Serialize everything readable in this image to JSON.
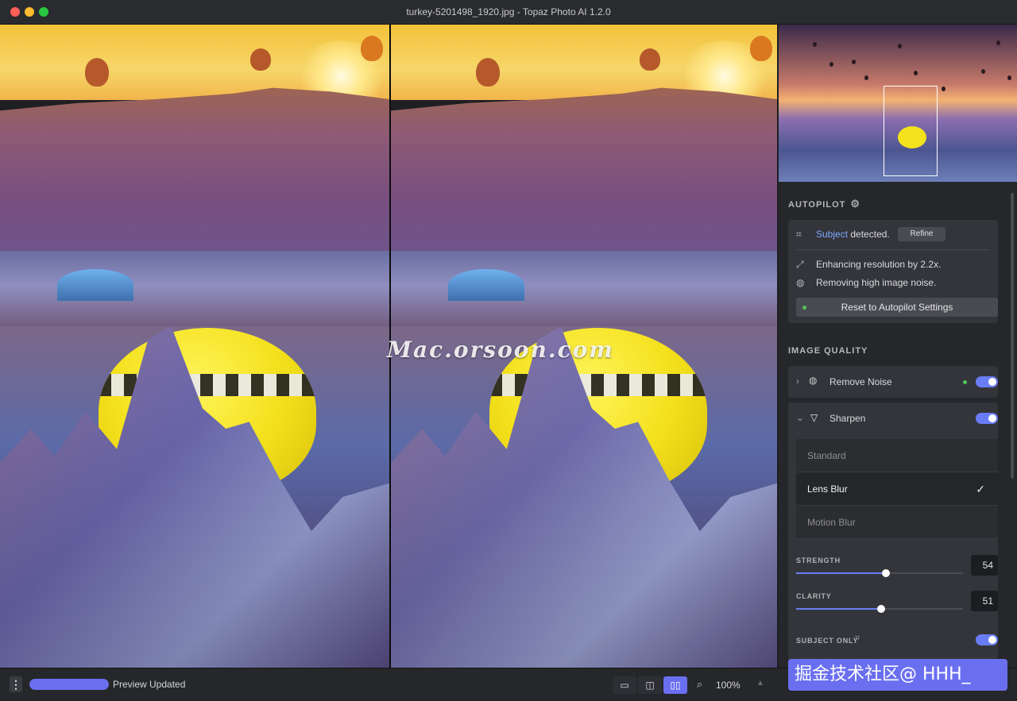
{
  "window": {
    "title": "turkey-5201498_1920.jpg - Topaz Photo AI 1.2.0"
  },
  "watermark": "Mac.orsoon.com",
  "sidebar": {
    "autopilot": {
      "heading": "AUTOPILOT",
      "subject_link": "Subject",
      "subject_suffix": "detected.",
      "refine_label": "Refine",
      "resolution_text": "Enhancing resolution by 2.2x.",
      "noise_text": "Removing high image noise.",
      "reset_label": "Reset to Autopilot Settings"
    },
    "image_quality": {
      "heading": "IMAGE QUALITY",
      "remove_noise": {
        "label": "Remove Noise",
        "enabled": true
      },
      "sharpen": {
        "label": "Sharpen",
        "enabled": true,
        "modes": [
          "Standard",
          "Lens Blur",
          "Motion Blur"
        ],
        "selected_mode": "Lens Blur",
        "strength": {
          "label": "STRENGTH",
          "value": 54
        },
        "clarity": {
          "label": "CLARITY",
          "value": 51
        },
        "subject_only": {
          "label": "SUBJECT ONLY",
          "enabled": true
        }
      }
    }
  },
  "bottombar": {
    "status": "Preview Updated",
    "progress": 1.0,
    "zoom": "100%",
    "active_view": "side-by-side"
  },
  "export_banner": "掘金技术社区@ HHH_",
  "colors": {
    "accent": "#6a6ff0",
    "link": "#7ea8ff",
    "toggle_on": "#6a7cf5",
    "status_dot": "#52c45a"
  },
  "icons": {
    "subject": "focus-frame-icon",
    "resolution": "expand-diagonal-icon",
    "noise": "noise-circle-icon",
    "sharpen": "triangle-down-icon",
    "settings": "gear-icon",
    "zoom": "magnifier-icon"
  }
}
